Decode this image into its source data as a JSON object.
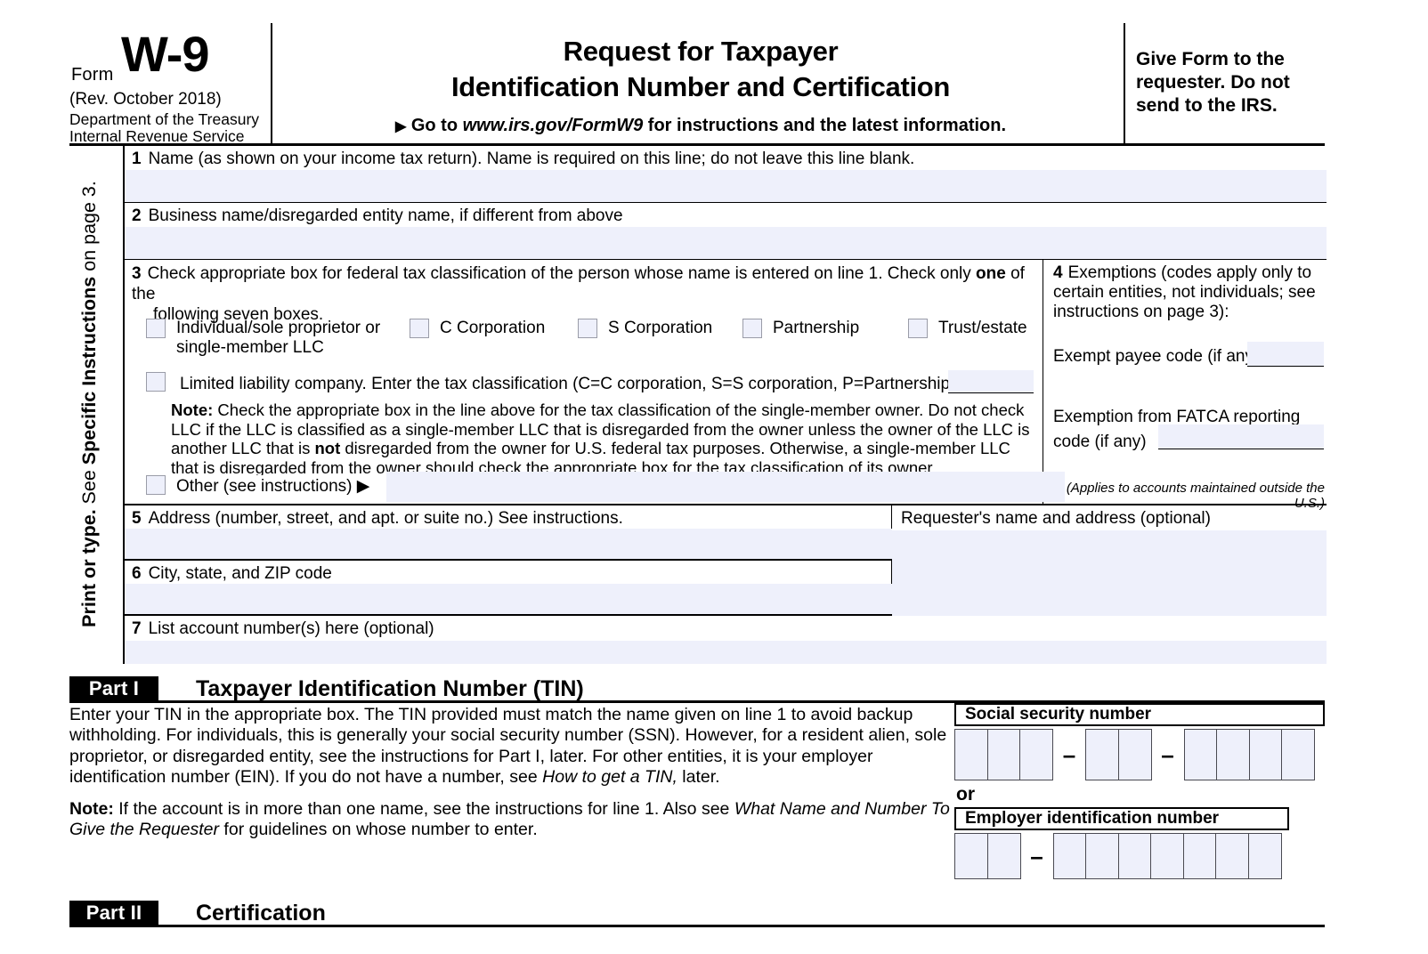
{
  "header": {
    "form_word": "Form",
    "form_number": "W-9",
    "revision": "(Rev. October 2018)",
    "department_line1": "Department of the Treasury",
    "department_line2": "Internal Revenue Service",
    "title_line1": "Request for Taxpayer",
    "title_line2": "Identification Number and Certification",
    "goto_arrow": "▶",
    "goto_prefix": "Go to",
    "goto_url": "www.irs.gov/FormW9",
    "goto_suffix": "for instructions and the latest information.",
    "give_form_note": "Give Form to the requester. Do not send to the IRS."
  },
  "sidebar": {
    "line1": "Print or type.",
    "line2_prefix": "See ",
    "line2_bold": "Specific Instructions",
    "line2_suffix": " on page 3."
  },
  "line1": {
    "number": "1",
    "label": "Name (as shown on your income tax return). Name is required on this line; do not leave this line blank.",
    "value": ""
  },
  "line2": {
    "number": "2",
    "label": "Business name/disregarded entity name, if different from above",
    "value": ""
  },
  "line3": {
    "number": "3",
    "instruction_part1": "Check appropriate box for federal tax classification of the person whose name is entered on line 1. Check only ",
    "instruction_bold": "one",
    "instruction_part2": " of the",
    "instruction_line2": "following seven boxes.",
    "checkboxes": [
      {
        "label_line1": "Individual/sole proprietor or",
        "label_line2": "single-member LLC",
        "checked": false
      },
      {
        "label_line1": "C Corporation",
        "label_line2": "",
        "checked": false
      },
      {
        "label_line1": "S Corporation",
        "label_line2": "",
        "checked": false
      },
      {
        "label_line1": "Partnership",
        "label_line2": "",
        "checked": false
      },
      {
        "label_line1": "Trust/estate",
        "label_line2": "",
        "checked": false
      }
    ],
    "llc": {
      "label": "Limited liability company. Enter the tax classification (C=C corporation, S=S corporation, P=Partnership)",
      "arrow": "▶",
      "value": ""
    },
    "note_bold": "Note:",
    "note_text_1": " Check the appropriate box in the line above for the tax classification of the single-member owner.  Do not check LLC if the LLC is classified as a single-member LLC that is disregarded from the owner unless the owner of the LLC is another LLC that is ",
    "note_bold_2": "not",
    "note_text_2": " disregarded from the owner for U.S. federal tax purposes. Otherwise, a single-member LLC that is disregarded from the owner should check the appropriate box for the tax classification of its owner.",
    "other": {
      "label": "Other (see instructions)",
      "arrow": "▶",
      "checked": false,
      "value": ""
    }
  },
  "line4": {
    "number": "4",
    "heading_line1": "Exemptions (codes apply only to",
    "heading_line2": "certain entities, not individuals; see",
    "heading_line3": "instructions on page 3):",
    "exempt_payee_label": "Exempt payee code (if any)",
    "exempt_payee_value": "",
    "fatca_label_line1": "Exemption from FATCA reporting",
    "fatca_label_line2": "code (if any)",
    "fatca_value": "",
    "applies_note": "(Applies to accounts maintained outside the U.S.)"
  },
  "line5": {
    "number": "5",
    "label": "Address (number, street, and apt. or suite no.) See instructions.",
    "value": ""
  },
  "line6": {
    "number": "6",
    "label": "City, state, and ZIP code",
    "value": ""
  },
  "line7": {
    "number": "7",
    "label": "List account number(s) here (optional)",
    "value": ""
  },
  "requester": {
    "label": "Requester's name and address (optional)",
    "value": ""
  },
  "part1": {
    "tag": "Part I",
    "title": "Taxpayer Identification Number (TIN)",
    "body_1": "Enter your TIN in the appropriate box. The TIN provided must match the name given on line 1 to avoid backup withholding. For individuals, this is generally your social security number (SSN). However, for a resident alien, sole proprietor, or disregarded entity, see the instructions for Part I, later. For other entities, it is your employer identification number (EIN). If you do not have a number, see ",
    "body_1_italic": "How to get a TIN,",
    "body_1_end": " later.",
    "note_bold": "Note:",
    "note_text": " If the account is in more than one name, see the instructions for line 1. Also see ",
    "note_italic": "What Name and Number To Give the Requester",
    "note_end": " for guidelines on whose number to enter.",
    "ssn_label": "Social security number",
    "ssn_groups": [
      3,
      2,
      4
    ],
    "ssn_separator": "–",
    "ssn_value": "",
    "or_word": "or",
    "ein_label": "Employer identification number",
    "ein_groups": [
      2,
      7
    ],
    "ein_separator": "–",
    "ein_value": ""
  },
  "part2": {
    "tag": "Part II",
    "title": "Certification"
  },
  "colors": {
    "field_fill": "#eef0fb",
    "checkbox_border": "#9a9ca8",
    "rule": "#000000"
  }
}
